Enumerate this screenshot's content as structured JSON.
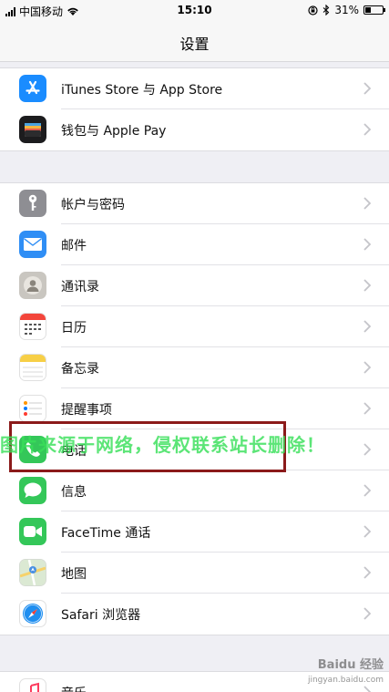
{
  "status_bar": {
    "carrier": "中国移动",
    "time": "15:10",
    "battery_percent": "31%",
    "battery_level": 0.31,
    "icons": [
      "signal-icon",
      "wifi-icon",
      "lock-rotation-icon",
      "bluetooth-icon",
      "battery-icon"
    ]
  },
  "nav": {
    "title": "设置"
  },
  "groups": [
    {
      "items": [
        {
          "label": "iTunes Store 与 App Store",
          "icon": "app-store-icon",
          "color": "#1a8cff"
        },
        {
          "label": "钱包与 Apple Pay",
          "icon": "wallet-icon",
          "color": "#1c1c1e"
        }
      ]
    },
    {
      "items": [
        {
          "label": "帐户与密码",
          "icon": "key-icon",
          "color": "#8e8e93"
        },
        {
          "label": "邮件",
          "icon": "mail-icon",
          "color": "#2f8ef5"
        },
        {
          "label": "通讯录",
          "icon": "contacts-icon",
          "color": "#b8b8b8"
        },
        {
          "label": "日历",
          "icon": "calendar-icon",
          "color": "#ffffff"
        },
        {
          "label": "备忘录",
          "icon": "notes-icon",
          "color": "#ffffff"
        },
        {
          "label": "提醒事项",
          "icon": "reminders-icon",
          "color": "#ffffff"
        },
        {
          "label": "电话",
          "icon": "phone-icon",
          "color": "#34c759"
        },
        {
          "label": "信息",
          "icon": "messages-icon",
          "color": "#34c759"
        },
        {
          "label": "FaceTime 通话",
          "icon": "facetime-icon",
          "color": "#34c759"
        },
        {
          "label": "地图",
          "icon": "maps-icon",
          "color": "#e6efe3"
        },
        {
          "label": "Safari 浏览器",
          "icon": "safari-icon",
          "color": "#ffffff"
        }
      ]
    },
    {
      "items": [
        {
          "label": "音乐",
          "icon": "music-icon",
          "color": "#ffffff"
        }
      ]
    }
  ],
  "overlay": {
    "watermark": "图片来源于网络，侵权联系站长删除！",
    "baidu_logo": "Baidu 经验",
    "baidu_url": "jingyan.baidu.com",
    "highlight_color": "#8b1a1a"
  }
}
